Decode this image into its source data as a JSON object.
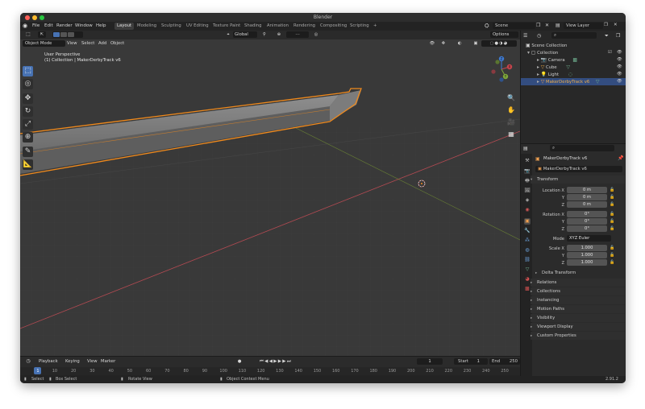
{
  "window": {
    "title": "Blender"
  },
  "menu": [
    "File",
    "Edit",
    "Render",
    "Window",
    "Help"
  ],
  "workspaces": [
    "Layout",
    "Modeling",
    "Sculpting",
    "UV Editing",
    "Texture Paint",
    "Shading",
    "Animation",
    "Rendering",
    "Compositing",
    "Scripting"
  ],
  "workspaces_add": "+",
  "scene": {
    "name": "Scene",
    "view_layer": "View Layer"
  },
  "viewport": {
    "mode": "Object Mode",
    "header_menus": [
      "View",
      "Select",
      "Add",
      "Object"
    ],
    "orientation": "Global",
    "options_label": "Options",
    "overlay_title": "User Perspective",
    "overlay_subtitle": "(1) Collection | MakerDerbyTrack v6",
    "gizmo": {
      "x": "X",
      "y": "Y",
      "z": "Z"
    }
  },
  "timeline": {
    "menus": [
      "Playback",
      "Keying",
      "View",
      "Marker"
    ],
    "current_frame": "1",
    "start_label": "Start",
    "start": "1",
    "end_label": "End",
    "end": "250",
    "ruler": [
      "1",
      "10",
      "20",
      "30",
      "40",
      "50",
      "60",
      "70",
      "80",
      "90",
      "100",
      "110",
      "120",
      "130",
      "140",
      "150",
      "160",
      "170",
      "180",
      "190",
      "200",
      "210",
      "220",
      "230",
      "240",
      "250"
    ]
  },
  "statusbar": {
    "select": "Select",
    "box_select": "Box Select",
    "rotate": "Rotate View",
    "context": "Object Context Menu",
    "version": "2.91.2"
  },
  "outliner": {
    "rows": [
      {
        "label": "Scene Collection"
      },
      {
        "label": "Collection"
      },
      {
        "label": "Camera"
      },
      {
        "label": "Cube"
      },
      {
        "label": "Light"
      },
      {
        "label": "MakerDerbyTrack v6"
      }
    ]
  },
  "properties": {
    "object_name": "MakerDerbyTrack v6",
    "object_field": "MakerDerbyTrack v6",
    "transform_title": "Transform",
    "location": {
      "label": "Location X",
      "y_label": "Y",
      "z_label": "Z",
      "x": "0 m",
      "y": "0 m",
      "z": "0 m"
    },
    "rotation": {
      "label": "Rotation X",
      "y_label": "Y",
      "z_label": "Z",
      "x": "0°",
      "y": "0°",
      "z": "0°"
    },
    "mode": {
      "label": "Mode",
      "value": "XYZ Euler"
    },
    "scale": {
      "label": "Scale X",
      "y_label": "Y",
      "z_label": "Z",
      "x": "1.000",
      "y": "1.000",
      "z": "1.000"
    },
    "delta_transform": "Delta Transform",
    "panels": [
      "Relations",
      "Collections",
      "Instancing",
      "Motion Paths",
      "Visibility",
      "Viewport Display",
      "Custom Properties"
    ]
  },
  "colors": {
    "accent": "#4772b3",
    "selection_outline": "#f08a1d",
    "x_axis": "#c84a52",
    "y_axis": "#8ab037"
  }
}
